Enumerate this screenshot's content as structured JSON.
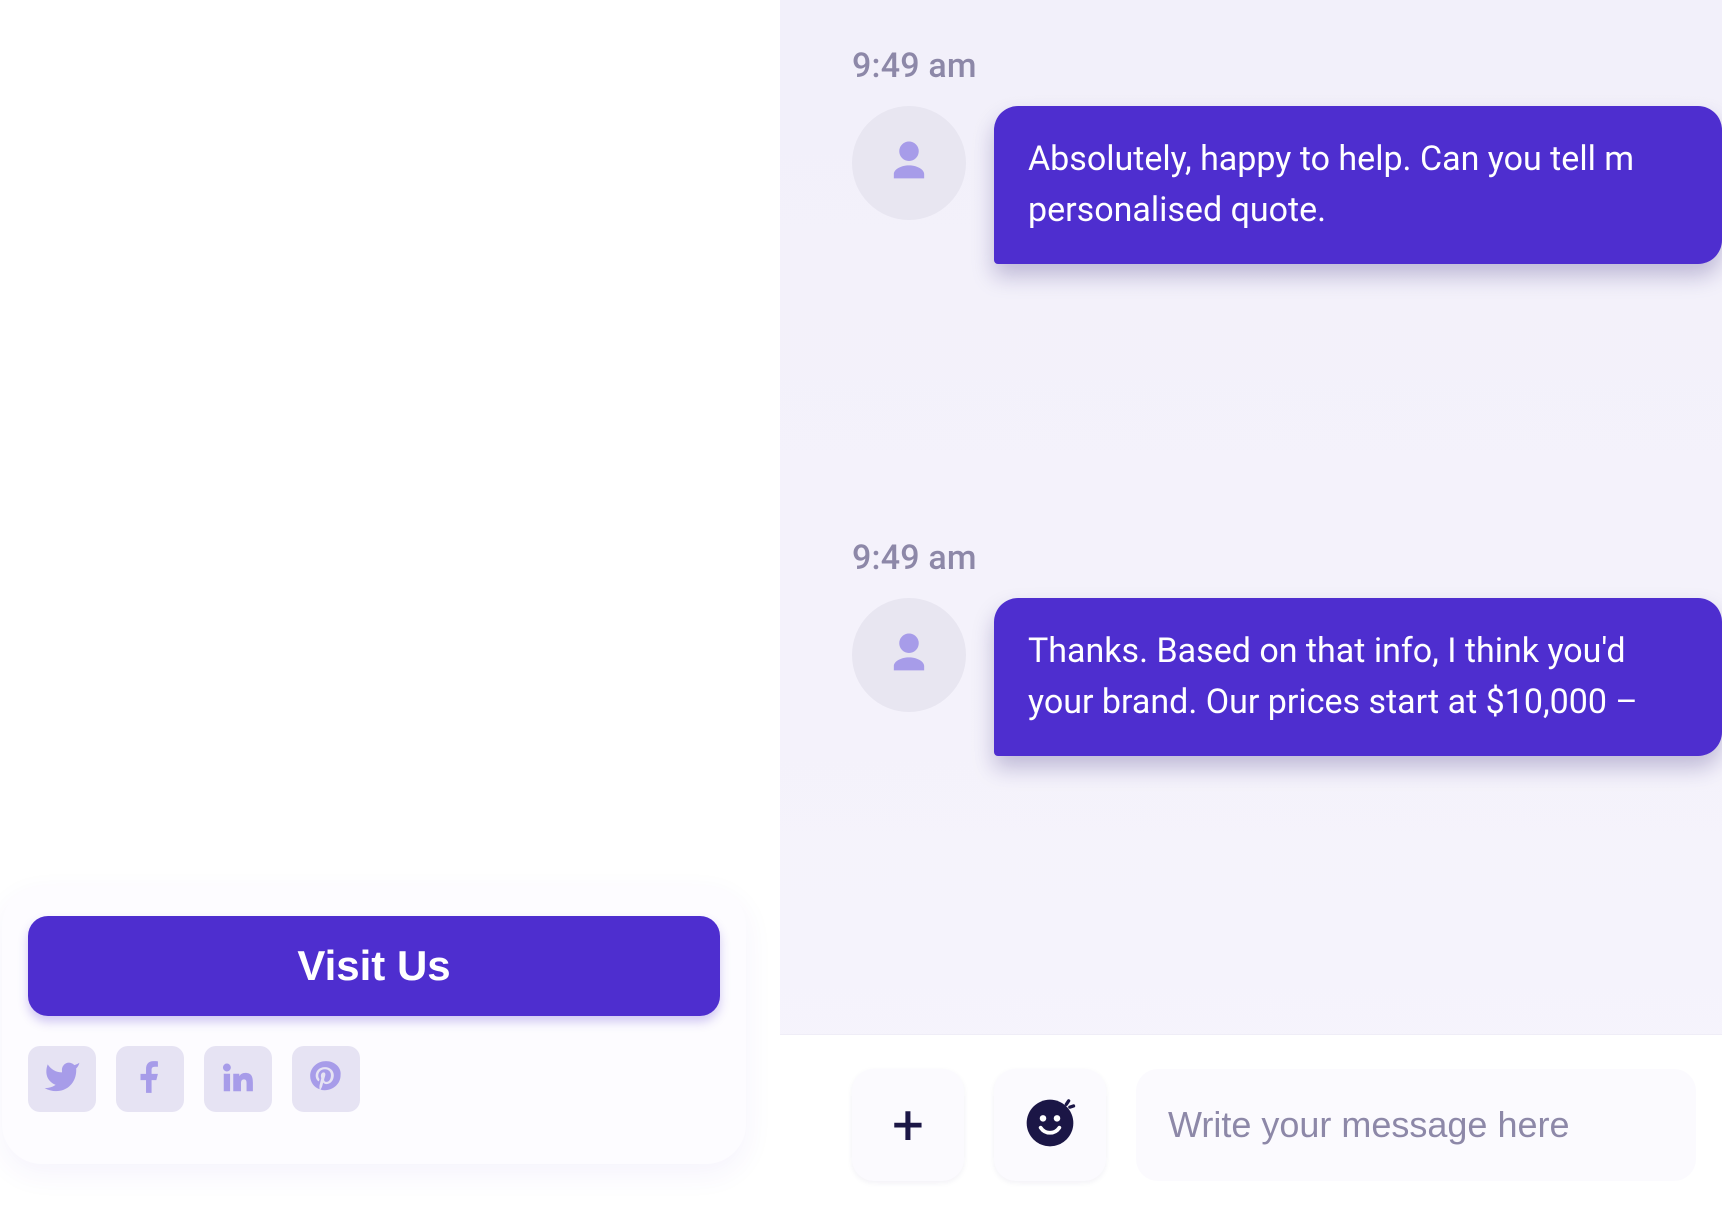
{
  "sidebar": {
    "visit_button_label": "Visit Us",
    "socials": [
      {
        "name": "twitter"
      },
      {
        "name": "facebook"
      },
      {
        "name": "linkedin"
      },
      {
        "name": "pinterest"
      }
    ]
  },
  "chat": {
    "messages": [
      {
        "time": "9:49 am",
        "text": "Absolutely, happy to help. Can you tell m\npersonalised quote."
      },
      {
        "time": "9:49 am",
        "text": "Thanks. Based on that info, I think you'd \nyour brand. Our prices start at $10,000 –"
      }
    ],
    "input": {
      "placeholder": "Write your message here"
    }
  },
  "colors": {
    "accent": "#4E2ECF"
  }
}
